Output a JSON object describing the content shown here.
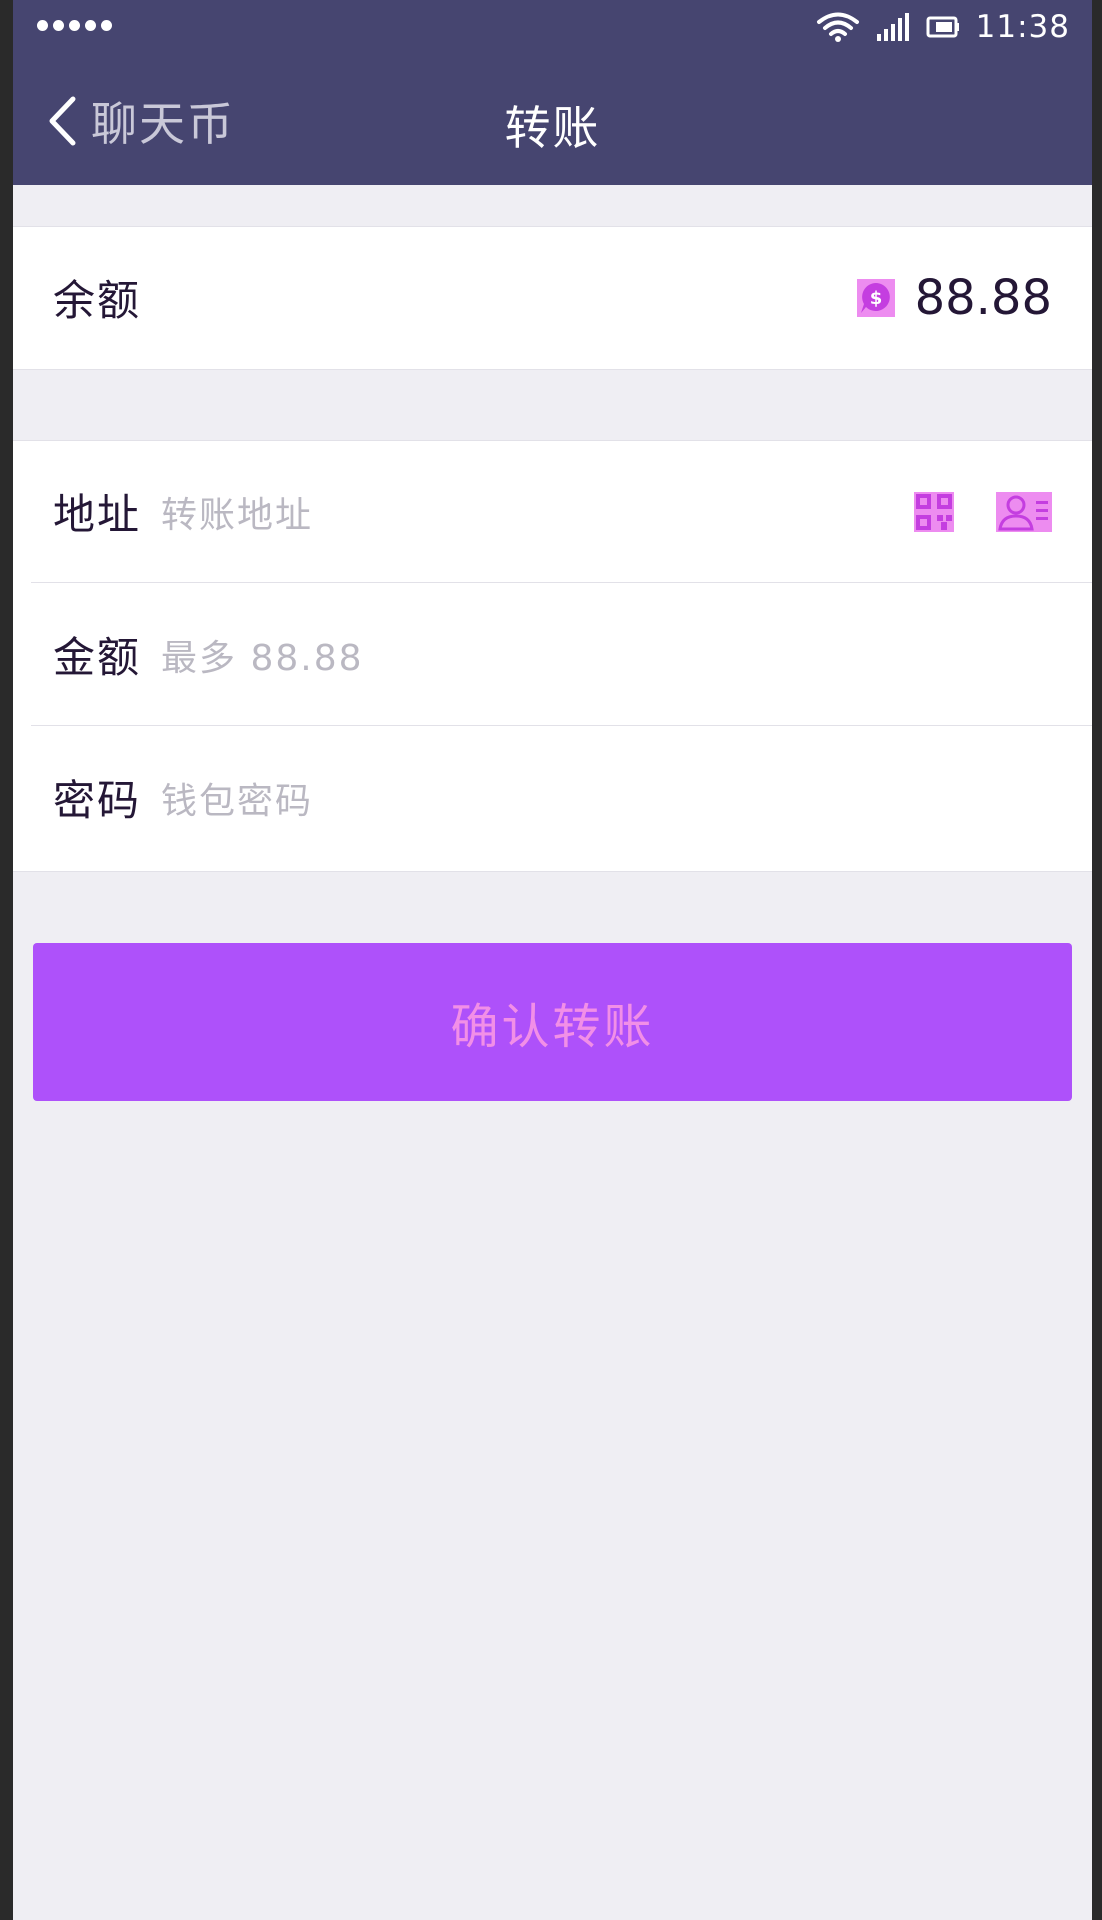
{
  "status_bar": {
    "time": "11:38",
    "icons": [
      "signal-dots-icon",
      "wifi-icon",
      "cellular-signal-icon",
      "battery-icon"
    ]
  },
  "header": {
    "back_label": "聊天币",
    "title": "转账"
  },
  "balance": {
    "label": "余额",
    "amount": "88.88",
    "icon": "coin-chat-icon"
  },
  "form": {
    "address": {
      "label": "地址",
      "placeholder": "转账地址",
      "icons": [
        "qr-code-icon",
        "contacts-icon"
      ]
    },
    "amount": {
      "label": "金额",
      "placeholder": "最多 88.88"
    },
    "password": {
      "label": "密码",
      "placeholder": "钱包密码"
    }
  },
  "confirm_button": {
    "label": "确认转账"
  },
  "colors": {
    "header_bg": "#464570",
    "page_bg": "#efeef3",
    "text_primary": "#241736",
    "placeholder": "#bab8c2",
    "button_bg": "#ae51fa",
    "button_text": "#f28fe7",
    "icon_accent": "#c43ee0"
  }
}
